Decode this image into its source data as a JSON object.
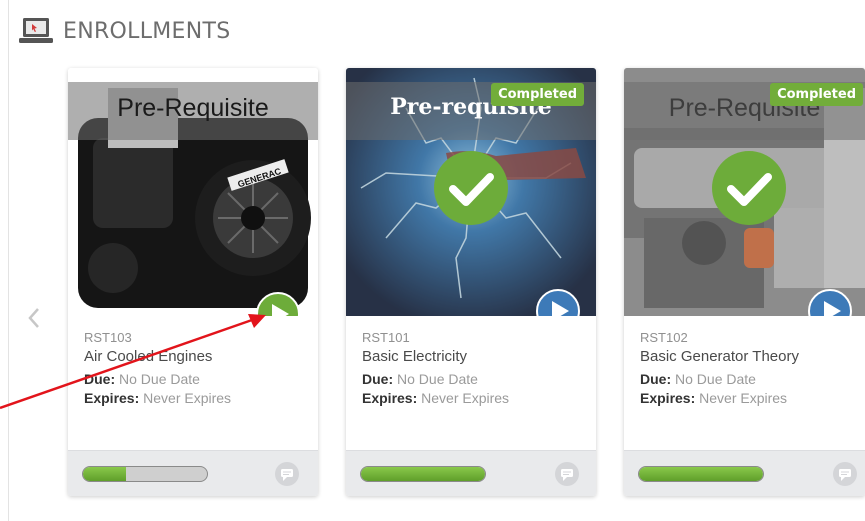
{
  "header": {
    "title": "ENROLLMENTS",
    "icon": "laptop-icon"
  },
  "carousel": {
    "prev_icon": "chevron-left-icon"
  },
  "colors": {
    "accent_green": "#72ad3a",
    "play_green": "#6dac3a",
    "play_blue": "#3d7ab8"
  },
  "cards": [
    {
      "code": "RST103",
      "title": "Air Cooled Engines",
      "due_label": "Due:",
      "due_value": "No Due Date",
      "expires_label": "Expires:",
      "expires_value": "Never Expires",
      "overlay": "Pre-Requisite",
      "badge": "",
      "progress": 0.35,
      "play_icon": "play-icon"
    },
    {
      "code": "RST101",
      "title": "Basic Electricity",
      "due_label": "Due:",
      "due_value": "No Due Date",
      "expires_label": "Expires:",
      "expires_value": "Never Expires",
      "overlay": "Pre-requisite",
      "badge": "Completed",
      "progress": 1.0,
      "play_icon": "play-icon"
    },
    {
      "code": "RST102",
      "title": "Basic Generator Theory",
      "due_label": "Due:",
      "due_value": "No Due Date",
      "expires_label": "Expires:",
      "expires_value": "Never Expires",
      "overlay": "Pre-Requisite",
      "badge": "Completed",
      "progress": 1.0,
      "play_icon": "play-icon"
    }
  ]
}
